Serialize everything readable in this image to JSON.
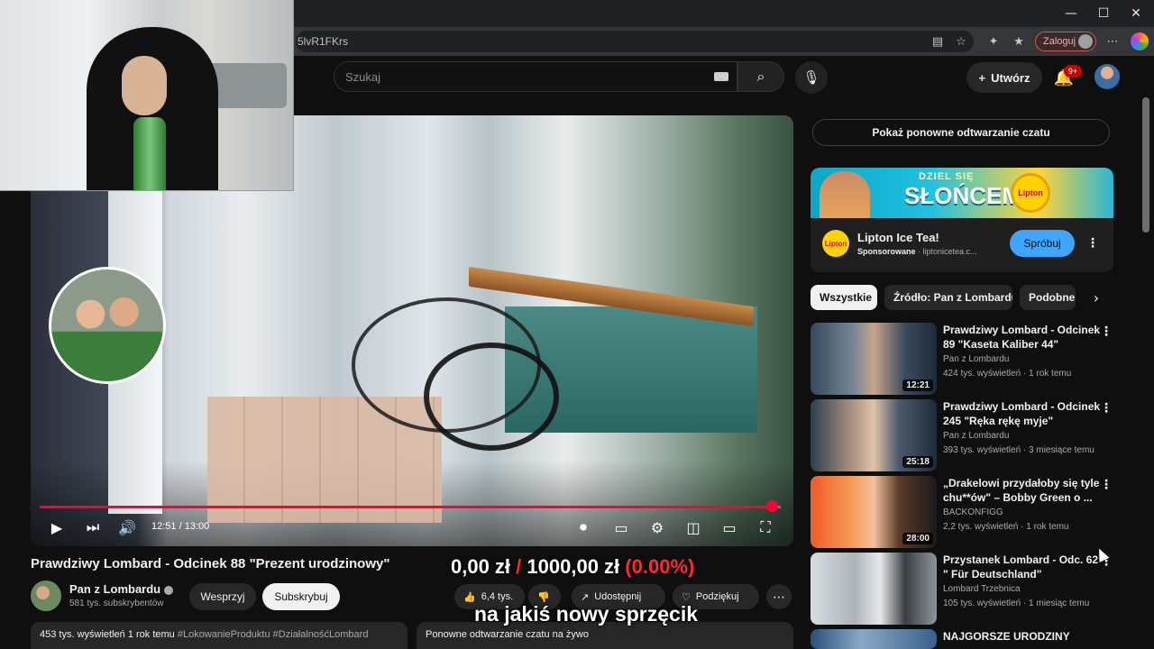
{
  "browser": {
    "url_fragment": "5lvR1FKrs",
    "profile_label": "Zaloguj",
    "window_controls": {
      "minimize": "—",
      "maximize": "☐",
      "close": "✕"
    }
  },
  "header": {
    "search_placeholder": "Szukaj",
    "create_label": "Utwórz",
    "notifications_badge": "9+"
  },
  "player": {
    "current_time": "12:51",
    "duration": "13:00",
    "progress_percent": 98.8,
    "time_separator": " / "
  },
  "stream_overlay": {
    "amount": "0,00 zł",
    "separator": "/",
    "goal": "1000,00 zł",
    "percent": "(0.00%)",
    "caption": "na jakiś nowy sprzęcik"
  },
  "video": {
    "title": "Prawdziwy Lombard - Odcinek 88 \"Prezent urodzinowy\"",
    "channel_name": "Pan z Lombardu",
    "subscribers": "581 tys. subskrybentów",
    "join_label": "Wesprzyj",
    "subscribe_label": "Subskrybuj",
    "likes": "6,4 tys.",
    "share_label": "Udostępnij",
    "thanks_label": "Podziękuj",
    "views_date": "453 tys. wyświetleń  1 rok temu",
    "hashtags": "#LokowanieProduktu #DziałalnośćLombard",
    "chat_replay_label": "Ponowne odtwarzanie czatu na żywo"
  },
  "sidebar": {
    "show_chat_replay": "Pokaż ponowne odtwarzanie czatu",
    "ad": {
      "banner_line1": "DZIEL SIĘ",
      "banner_line2": "SŁOŃCEM",
      "logo_text": "Lipton",
      "title": "Lipton Ice Tea!",
      "sponsored": "Sponsorowane",
      "domain": " · liptonicetea.c...",
      "cta": "Spróbuj"
    },
    "chips": [
      "Wszystkie",
      "Źródło: Pan z Lombardu",
      "Podobne"
    ],
    "recommendations": [
      {
        "title": "Prawdziwy Lombard - Odcinek 89 \"Kaseta Kaliber 44\"",
        "channel": "Pan z Lombardu",
        "meta": "424 tys. wyświetleń · 1 rok temu",
        "duration": "12:21"
      },
      {
        "title": "Prawdziwy Lombard - Odcinek 245 \"Ręka rękę myje\"",
        "channel": "Pan z Lombardu",
        "meta": "393 tys. wyświetleń · 3 miesiące temu",
        "duration": "25:18"
      },
      {
        "title": "„Drakelowi przydałoby się tyle chu**ów\" – Bobby Green o ...",
        "channel": "BACKONFIGG",
        "meta": "2,2 tys. wyświetleń · 1 rok temu",
        "duration": "28:00"
      },
      {
        "title": "Przystanek Lombard - Odc. 62 \" Für Deutschland\"",
        "channel": "Lombard Trzebnica",
        "meta": "105 tys. wyświetleń · 1 miesiąc temu",
        "duration": ""
      },
      {
        "title": "NAJGORSZE URODZINY",
        "channel": "",
        "meta": "",
        "duration": ""
      }
    ]
  },
  "colors": {
    "accent_red": "#ff0033",
    "subscribe_bg": "#f1f1f1",
    "cta_blue": "#3ea6ff",
    "bg": "#0f0f0f"
  }
}
